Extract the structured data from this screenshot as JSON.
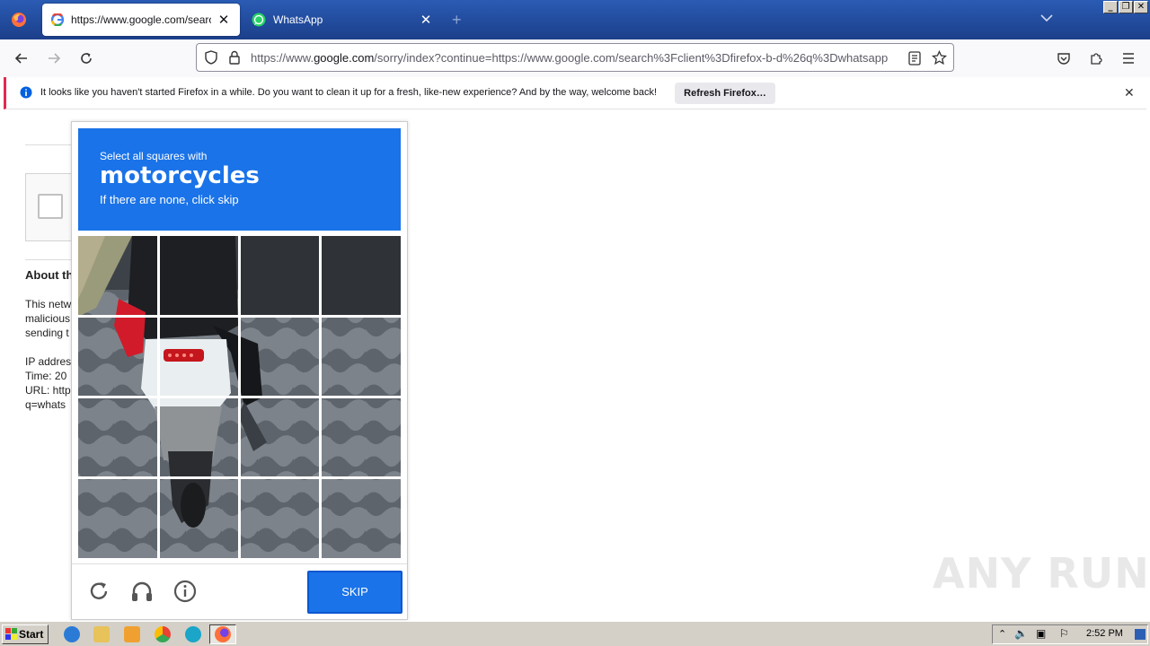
{
  "browser": {
    "tabs": [
      {
        "label": "https://www.google.com/search?c",
        "active": true
      },
      {
        "label": "WhatsApp",
        "active": false
      }
    ],
    "url": {
      "prefix": "https://www.",
      "host": "google.com",
      "rest": "/sorry/index?continue=https://www.google.com/search%3Fclient%3Dfirefox-b-d%26q%3Dwhatsapp"
    }
  },
  "notification": {
    "text": "It looks like you haven't started Firefox in a while. Do you want to clean it up for a fresh, like-new experience? And by the way, welcome back!",
    "button": "Refresh Firefox…"
  },
  "page": {
    "about_heading": "About th",
    "lines": [
      "This netw",
      "malicious",
      "sending t",
      "",
      "IP addres",
      "Time: 20",
      "URL: http",
      "q=whats"
    ]
  },
  "captcha": {
    "instruction": "Select all squares with",
    "target": "motorcycles",
    "subtext": "If there are none, click skip",
    "skip_label": "SKIP",
    "grid_rows": 4,
    "grid_cols": 4
  },
  "watermark": "ANY RUN",
  "taskbar": {
    "start_label": "Start",
    "clock": "2:52 PM"
  },
  "colors": {
    "captcha_blue": "#1a73e8",
    "notif_accent": "#e22850"
  }
}
